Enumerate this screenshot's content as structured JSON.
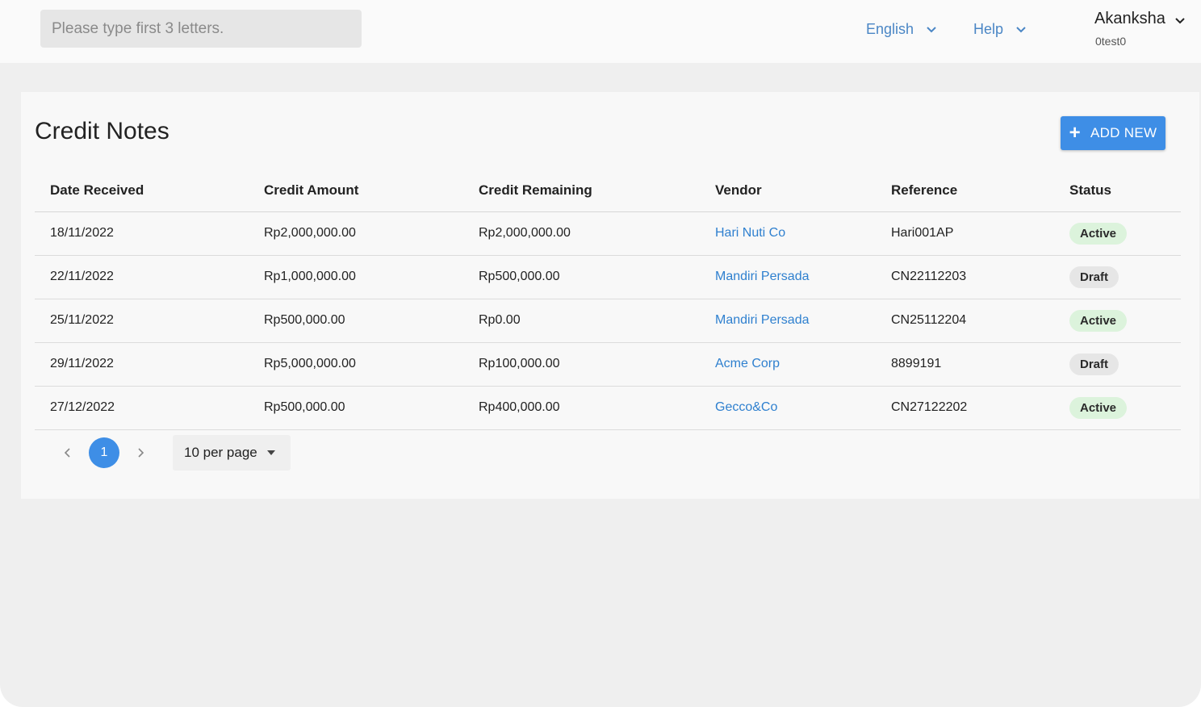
{
  "header": {
    "search_placeholder": "Please type first 3 letters.",
    "language": "English",
    "help": "Help",
    "user_name": "Akanksha",
    "user_sub": "0test0"
  },
  "page": {
    "title": "Credit Notes",
    "add_button": "ADD NEW"
  },
  "table": {
    "columns": [
      "Date Received",
      "Credit Amount",
      "Credit Remaining",
      "Vendor",
      "Reference",
      "Status"
    ],
    "rows": [
      {
        "date": "18/11/2022",
        "amount": "Rp2,000,000.00",
        "remaining": "Rp2,000,000.00",
        "vendor": "Hari Nuti Co",
        "reference": "Hari001AP",
        "status": "Active"
      },
      {
        "date": "22/11/2022",
        "amount": "Rp1,000,000.00",
        "remaining": "Rp500,000.00",
        "vendor": "Mandiri Persada",
        "reference": "CN22112203",
        "status": "Draft"
      },
      {
        "date": "25/11/2022",
        "amount": "Rp500,000.00",
        "remaining": "Rp0.00",
        "vendor": "Mandiri Persada",
        "reference": "CN25112204",
        "status": "Active"
      },
      {
        "date": "29/11/2022",
        "amount": "Rp5,000,000.00",
        "remaining": "Rp100,000.00",
        "vendor": "Acme Corp",
        "reference": "8899191",
        "status": "Draft"
      },
      {
        "date": "27/12/2022",
        "amount": "Rp500,000.00",
        "remaining": "Rp400,000.00",
        "vendor": "Gecco&Co",
        "reference": "CN27122202",
        "status": "Active"
      }
    ]
  },
  "pagination": {
    "current_page": "1",
    "per_page": "10 per page"
  },
  "colors": {
    "accent": "#3e8ee6",
    "link": "#2f80cf",
    "active_badge": "#dcf3dc",
    "draft_badge": "#e6e6e6"
  }
}
